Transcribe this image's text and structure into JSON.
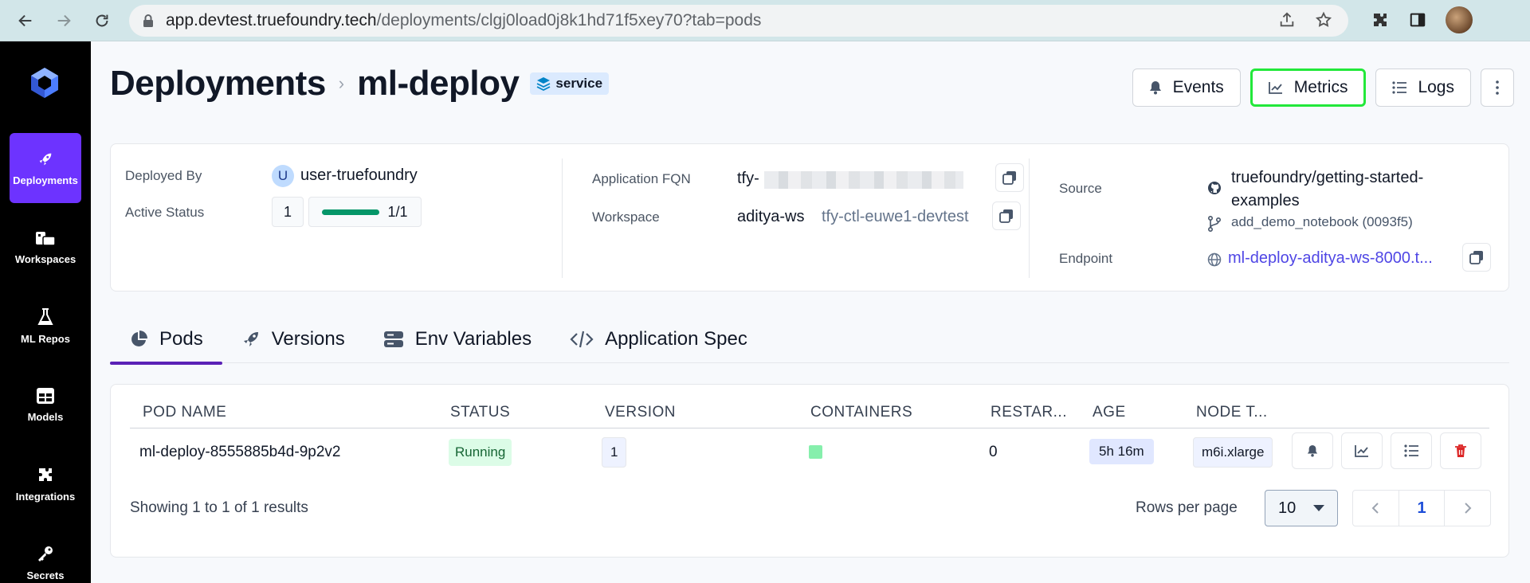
{
  "browser": {
    "url_host": "app.devtest.truefoundry.tech",
    "url_path": "/deployments/clgj0load0j8k1hd71f5xey70?tab=pods"
  },
  "sidebar": {
    "items": [
      {
        "label": "Deployments",
        "icon": "rocket-icon"
      },
      {
        "label": "Workspaces",
        "icon": "workspace-icon"
      },
      {
        "label": "ML Repos",
        "icon": "flask-icon"
      },
      {
        "label": "Models",
        "icon": "table-icon"
      },
      {
        "label": "Integrations",
        "icon": "puzzle-icon"
      },
      {
        "label": "Secrets",
        "icon": "key-icon"
      }
    ]
  },
  "header": {
    "breadcrumb_root": "Deployments",
    "title": "ml-deploy",
    "badge": "service",
    "actions": {
      "events": "Events",
      "metrics": "Metrics",
      "logs": "Logs"
    }
  },
  "info": {
    "deployed_by_label": "Deployed By",
    "deployed_by_initial": "U",
    "deployed_by": "user-truefoundry",
    "active_status_label": "Active Status",
    "active_count": "1",
    "active_ratio": "1/1",
    "fqn_label": "Application FQN",
    "fqn_prefix": "tfy-",
    "workspace_label": "Workspace",
    "workspace_name": "aditya-ws",
    "workspace_cluster": "tfy-ctl-euwe1-devtest",
    "source_label": "Source",
    "source_repo": "truefoundry/getting-started-examples",
    "source_branch": "add_demo_notebook (0093f5)",
    "endpoint_label": "Endpoint",
    "endpoint": "ml-deploy-aditya-ws-8000.t..."
  },
  "tabs": [
    {
      "label": "Pods"
    },
    {
      "label": "Versions"
    },
    {
      "label": "Env Variables"
    },
    {
      "label": "Application Spec"
    }
  ],
  "pods": {
    "columns": [
      "POD NAME",
      "STATUS",
      "VERSION",
      "CONTAINERS",
      "RESTAR...",
      "AGE",
      "NODE T..."
    ],
    "rows": [
      {
        "name": "ml-deploy-8555885b4d-9p2v2",
        "status": "Running",
        "version": "1",
        "restarts": "0",
        "age": "5h 16m",
        "node_type": "m6i.xlarge"
      }
    ],
    "showing": "Showing 1 to 1 of 1 results",
    "rows_per_page_label": "Rows per page",
    "rows_per_page": "10",
    "current_page": "1"
  }
}
